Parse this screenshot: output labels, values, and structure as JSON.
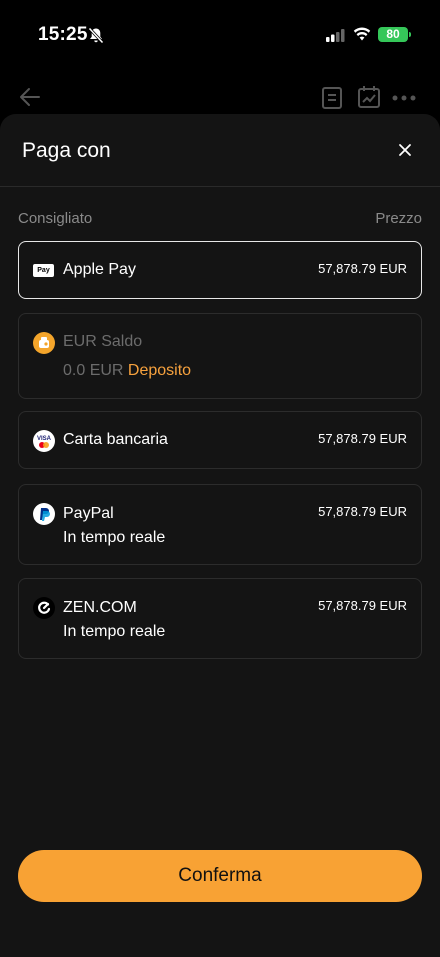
{
  "status_bar": {
    "time": "15:25",
    "battery": "80"
  },
  "sheet": {
    "title": "Paga con",
    "column_left": "Consigliato",
    "column_right": "Prezzo"
  },
  "methods": [
    {
      "name": "Apple Pay",
      "icon": "apple-pay-icon",
      "price": "57,878.79 EUR",
      "selected": true,
      "icon_text": "Pay"
    },
    {
      "name": "EUR Saldo",
      "icon": "wallet-coin-icon",
      "balance": "0.0 EUR",
      "action": "Deposito",
      "disabled": true
    },
    {
      "name": "Carta bancaria",
      "icon": "card-icon",
      "price": "57,878.79 EUR",
      "icon_text": "VISA"
    },
    {
      "name": "PayPal",
      "icon": "paypal-icon",
      "price": "57,878.79 EUR",
      "sub": "In tempo reale"
    },
    {
      "name": "ZEN.COM",
      "icon": "zen-icon",
      "price": "57,878.79 EUR",
      "sub": "In tempo reale"
    }
  ],
  "confirm_label": "Conferma",
  "colors": {
    "accent": "#f8a234",
    "sheet_bg": "#141414",
    "battery": "#35c759"
  }
}
